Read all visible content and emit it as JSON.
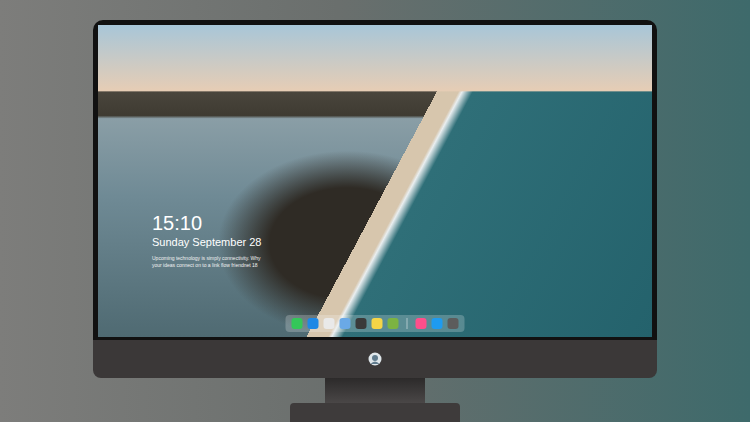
{
  "desktop": {
    "lock_screen": {
      "time": "15:10",
      "date": "Sunday September 28",
      "caption_lines": [
        "Upcoming technology is simply connectivity. Why",
        "your ideas connect on to a link flow friendnet 18"
      ]
    }
  },
  "dock": {
    "apps": [
      {
        "color": "#34c759"
      },
      {
        "color": "#1e88e5"
      },
      {
        "color": "#e9e9e9"
      },
      {
        "color": "#6aa9e6"
      },
      {
        "color": "#3a3a3a"
      },
      {
        "color": "#f5d547"
      },
      {
        "color": "#7cb342"
      }
    ],
    "pinned": [
      {
        "color": "#ff4f8b"
      },
      {
        "color": "#1e9bf0"
      },
      {
        "color": "#5c5c5c"
      }
    ]
  }
}
